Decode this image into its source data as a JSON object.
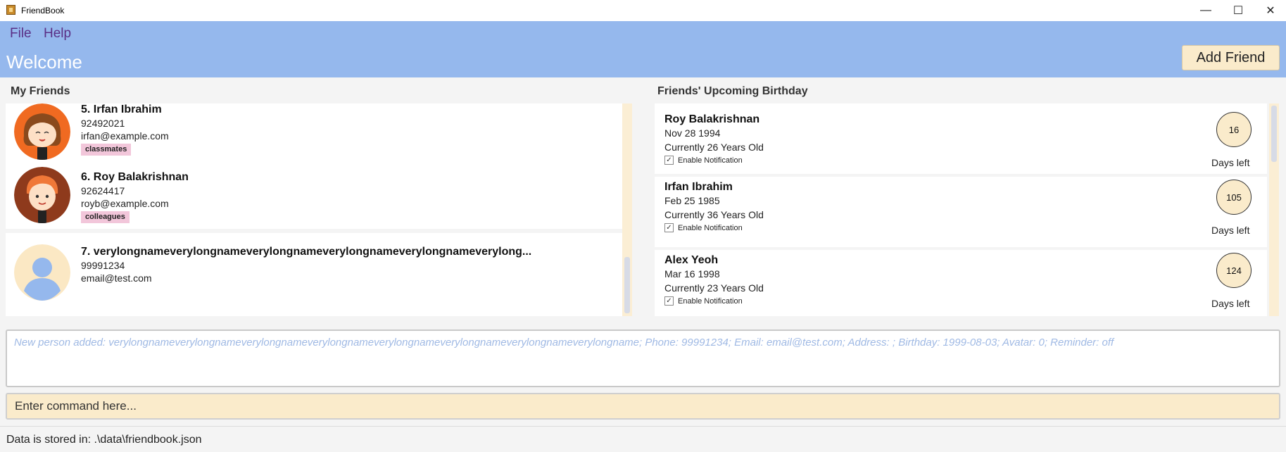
{
  "window": {
    "title": "FriendBook",
    "icons": [
      "app-icon",
      "minimize-icon",
      "maximize-icon",
      "close-icon"
    ]
  },
  "menu": {
    "items": [
      {
        "label": "File"
      },
      {
        "label": "Help"
      }
    ]
  },
  "header": {
    "welcome": "Welcome",
    "add_friend_label": "Add Friend",
    "background_color": "#95b8ed"
  },
  "friends": {
    "title": "My Friends",
    "items": [
      {
        "name": "5. Irfan Ibrahim",
        "phone": "92492021",
        "email": "irfan@example.com",
        "tag": "classmates",
        "avatar": "girl-avatar"
      },
      {
        "name": "6. Roy Balakrishnan",
        "phone": "92624417",
        "email": "royb@example.com",
        "tag": "colleagues",
        "avatar": "redhead-avatar"
      },
      {
        "name": "7. verylongnameverylongnameverylongnameverylongnameverylongnameverylong...",
        "phone": "99991234",
        "email": "email@test.com",
        "avatar": "default-user-avatar"
      }
    ]
  },
  "birthdays": {
    "title": "Friends' Upcoming Birthday",
    "notification_label": "Enable Notification",
    "days_left_label": "Days left",
    "items": [
      {
        "name": "Roy Balakrishnan",
        "date": "Nov 28 1994",
        "age": "Currently 26 Years Old",
        "days": "16",
        "notify": true
      },
      {
        "name": "Irfan Ibrahim",
        "date": "Feb 25 1985",
        "age": "Currently 36 Years Old",
        "days": "105",
        "notify": true
      },
      {
        "name": "Alex Yeoh",
        "date": "Mar 16 1998",
        "age": "Currently 23 Years Old",
        "days": "124",
        "notify": true
      }
    ]
  },
  "result": {
    "text": "New person added: verylongnameverylongnameverylongnameverylongnameverylongnameverylongnameverylongnameverylongname; Phone: 99991234; Email: email@test.com; Address: ; Birthday: 1999-08-03; Avatar: 0; Reminder: off"
  },
  "command": {
    "placeholder": "Enter command here..."
  },
  "status": {
    "text": "Data is stored in: .\\data\\friendbook.json"
  },
  "colors": {
    "accent": "#faebcb",
    "tag": "#f2c6da",
    "result_text": "#9fb9e4"
  }
}
